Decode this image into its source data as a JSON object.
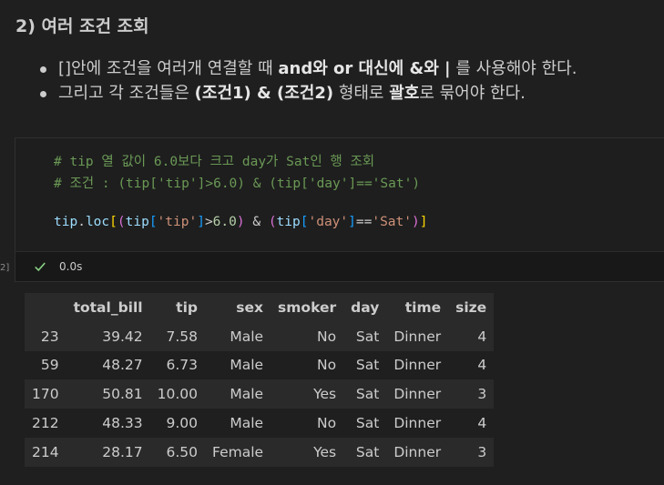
{
  "markdown": {
    "heading": "2) 여러 조건 조회",
    "bullet1": {
      "t1": "[]안에 조건을 여러개 연결할 때 ",
      "b1": "and와 or 대신에 &와 |",
      "t2": " 를 사용해야 한다."
    },
    "bullet2": {
      "t1": "그리고 각 조건들은 ",
      "b1": "(조건1) & (조건2)",
      "t2": " 형태로 ",
      "b2": "괄호",
      "t3": "로 묶어야 한다."
    }
  },
  "code_cell": {
    "comment1": "# tip 열 값이 6.0보다 크고 day가 Sat인 행 조회",
    "comment2": "# 조건 : (tip['tip']>6.0) & (tip['day']=='Sat')",
    "code": {
      "var": "tip",
      "dot": ".",
      "attr": "loc",
      "open_sq": "[",
      "open_p1": "(",
      "var2": "tip",
      "open_sq2": "[",
      "str1": "'tip'",
      "close_sq2": "]",
      "op1": ">",
      "num1": "6.0",
      "close_p1": ")",
      "amp": " & ",
      "open_p2": "(",
      "var3": "tip",
      "open_sq3": "[",
      "str2": "'day'",
      "close_sq3": "]",
      "op2": "==",
      "str3": "'Sat'",
      "close_p2": ")",
      "close_sq": "]"
    },
    "exec_time": "0.0s",
    "exec_count": "2]"
  },
  "table": {
    "columns": [
      "",
      "total_bill",
      "tip",
      "sex",
      "smoker",
      "day",
      "time",
      "size"
    ],
    "rows": [
      [
        "23",
        "39.42",
        "7.58",
        "Male",
        "No",
        "Sat",
        "Dinner",
        "4"
      ],
      [
        "59",
        "48.27",
        "6.73",
        "Male",
        "No",
        "Sat",
        "Dinner",
        "4"
      ],
      [
        "170",
        "50.81",
        "10.00",
        "Male",
        "Yes",
        "Sat",
        "Dinner",
        "3"
      ],
      [
        "212",
        "48.33",
        "9.00",
        "Male",
        "No",
        "Sat",
        "Dinner",
        "4"
      ],
      [
        "214",
        "28.17",
        "6.50",
        "Female",
        "Yes",
        "Sat",
        "Dinner",
        "3"
      ]
    ]
  },
  "colors": {
    "background": "#1f1f1f",
    "comment": "#6a9955",
    "string": "#ce9178",
    "number": "#b5cea8",
    "variable": "#9cdcfe",
    "success_check": "#89d185"
  },
  "icons": {
    "status": "check-icon"
  }
}
